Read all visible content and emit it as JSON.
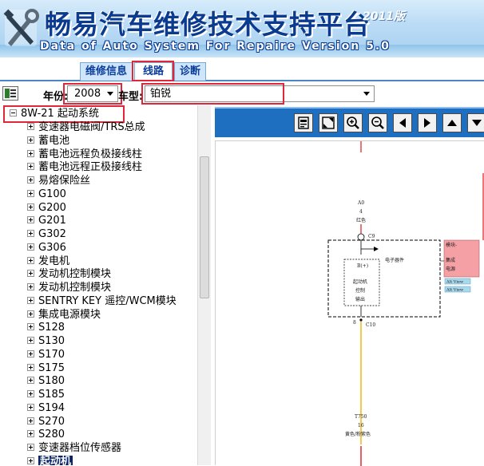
{
  "banner": {
    "title": "畅易汽车维修技术支持平台",
    "version_badge": "2011版",
    "subtitle": "Data of Auto System For Repaire Version 5.0"
  },
  "tabs": [
    {
      "label": "维修信息",
      "active": false
    },
    {
      "label": "线路",
      "active": true
    },
    {
      "label": "诊断",
      "active": false
    }
  ],
  "filter": {
    "year_label": "年份:",
    "year_value": "2008",
    "model_label": "车型:",
    "model_value": "铂锐"
  },
  "tree": {
    "root_label": "8W-21 起动系统",
    "items": [
      {
        "label": "变速器电磁阀/TRS总成"
      },
      {
        "label": "蓄电池"
      },
      {
        "label": "蓄电池远程负极接线柱"
      },
      {
        "label": "蓄电池远程正极接线柱"
      },
      {
        "label": "易熔保险丝"
      },
      {
        "label": "G100"
      },
      {
        "label": "G200"
      },
      {
        "label": "G201"
      },
      {
        "label": "G302"
      },
      {
        "label": "G306"
      },
      {
        "label": "发电机"
      },
      {
        "label": "发动机控制模块"
      },
      {
        "label": "发动机控制模块"
      },
      {
        "label": "SENTRY KEY 遥控/WCM模块"
      },
      {
        "label": "集成电源模块"
      },
      {
        "label": "S128"
      },
      {
        "label": "S130"
      },
      {
        "label": "S170"
      },
      {
        "label": "S175"
      },
      {
        "label": "S180"
      },
      {
        "label": "S185"
      },
      {
        "label": "S194"
      },
      {
        "label": "S270"
      },
      {
        "label": "S280"
      },
      {
        "label": "变速器档位传感器"
      },
      {
        "label": "起动机",
        "selected": true
      }
    ]
  },
  "diagram": {
    "top_wire_code": "A0",
    "top_wire_num": "4",
    "top_wire_color": "红色",
    "top_connector": "C9",
    "component_label": "电子器件",
    "pin_label": "B(+)",
    "relay_lines": [
      "起动机",
      "控制",
      "输出"
    ],
    "bottom_pin": "8",
    "bottom_connector": "C10",
    "module_lines": [
      "模块-",
      "集成",
      "电源"
    ],
    "tag_1": "Alt View",
    "tag_2": "Alt View",
    "bottom_wire_code": "T750",
    "bottom_wire_num": "16",
    "bottom_wire_color": "黄色/粉紫色"
  },
  "colors": {
    "accent": "#1f6fc0",
    "highlight_box": "#e2263a",
    "wire_red": "#e01b1b",
    "wire_yellow": "#f0b400",
    "selection": "#0a246a"
  },
  "icons": {
    "filter_toggle": "tree-toggle-icon",
    "toolbar": [
      "print-icon",
      "fullscreen-icon",
      "zoom-in-icon",
      "zoom-out-icon",
      "arrow-left-icon",
      "arrow-right-icon",
      "arrow-up-icon",
      "arrow-down-icon"
    ]
  }
}
